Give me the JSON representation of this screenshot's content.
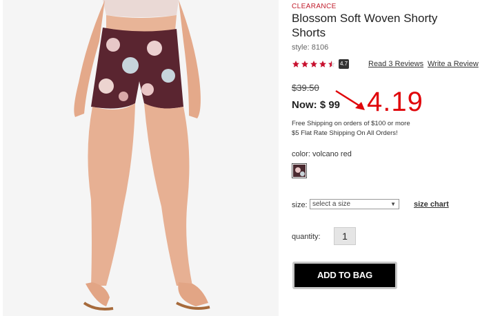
{
  "product": {
    "badge": "CLEARANCE",
    "title": "Blossom Soft Woven Shorty Shorts",
    "style": "style: 8106",
    "rating": "4.7",
    "stars": 4.7,
    "read_reviews": "Read 3 Reviews",
    "write_review": "Write a Review",
    "was_price": "$39.50",
    "now_price": "Now: $ 99",
    "annotation_price": "4.19",
    "shipping_line1": "Free Shipping on orders of $100 or more",
    "shipping_line2": "$5 Flat Rate Shipping On All Orders!",
    "color_label": "color: volcano red",
    "size_label": "size:",
    "size_select": "select a size",
    "size_chart": "size chart",
    "quantity_label": "quantity:",
    "quantity": "1",
    "add_to_bag": "ADD TO BAG"
  },
  "colors": {
    "accent": "#e0060b",
    "badge": "#c01a2a",
    "star": "#c8102e"
  },
  "icons": {
    "star": "star-icon",
    "arrow": "annotation-arrow-icon",
    "caret": "chevron-down-icon"
  }
}
